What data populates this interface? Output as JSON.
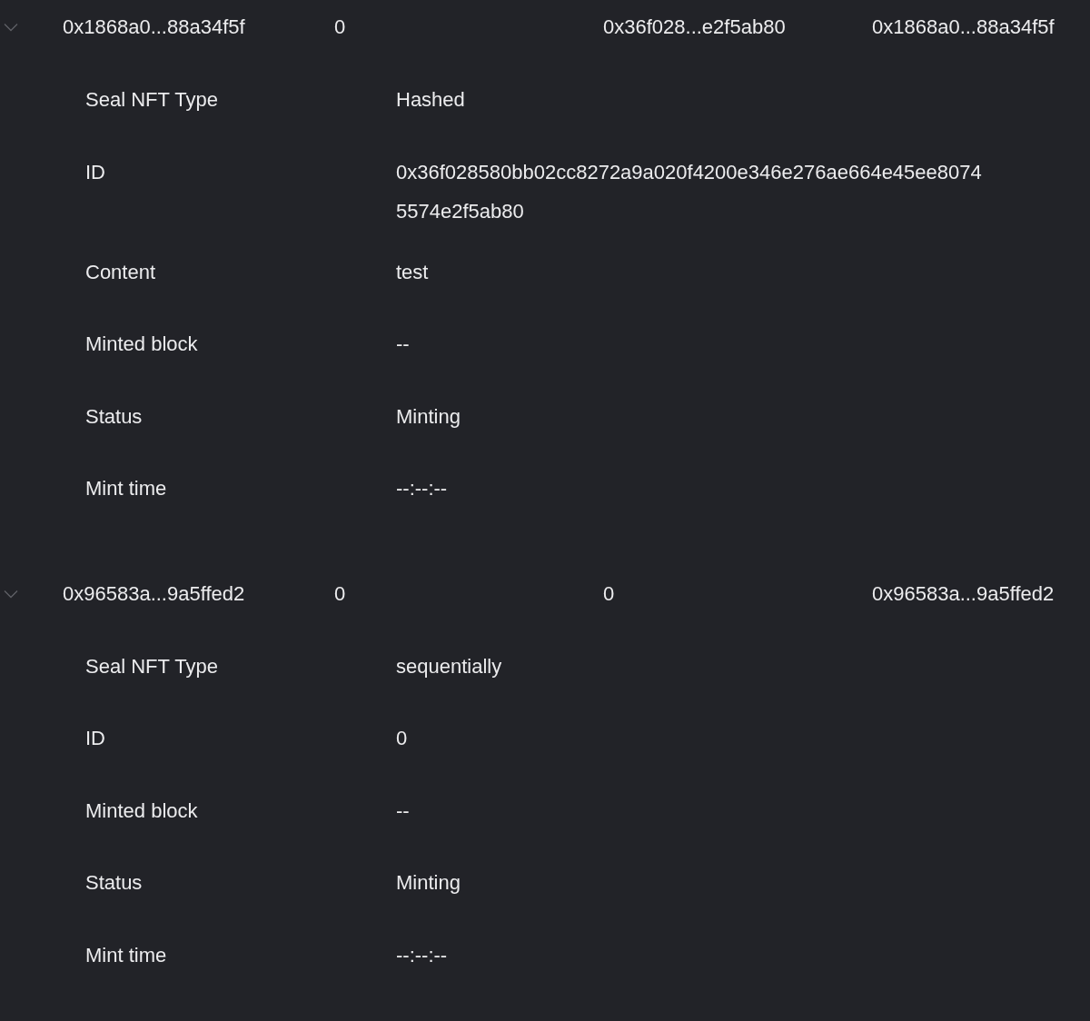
{
  "records": [
    {
      "expanded": true,
      "cells": [
        "0x1868a0...88a34f5f",
        "0",
        "0x36f028...e2f5ab80",
        "0x1868a0...88a34f5f"
      ],
      "details": [
        {
          "label": "Seal NFT Type",
          "value": "Hashed"
        },
        {
          "label": "ID",
          "value": "0x36f028580bb02cc8272a9a020f4200e346e276ae664e45ee80745574e2f5ab80"
        },
        {
          "label": "Content",
          "value": "test"
        },
        {
          "label": "Minted block",
          "value": "--"
        },
        {
          "label": "Status",
          "value": "Minting"
        },
        {
          "label": "Mint time",
          "value": "--:--:--"
        }
      ]
    },
    {
      "expanded": true,
      "cells": [
        "0x96583a...9a5ffed2",
        "0",
        "0",
        "0x96583a...9a5ffed2"
      ],
      "details": [
        {
          "label": "Seal NFT Type",
          "value": "sequentially"
        },
        {
          "label": "ID",
          "value": "0"
        },
        {
          "label": "Minted block",
          "value": "--"
        },
        {
          "label": "Status",
          "value": "Minting"
        },
        {
          "label": "Mint time",
          "value": "--:--:--"
        }
      ]
    }
  ]
}
